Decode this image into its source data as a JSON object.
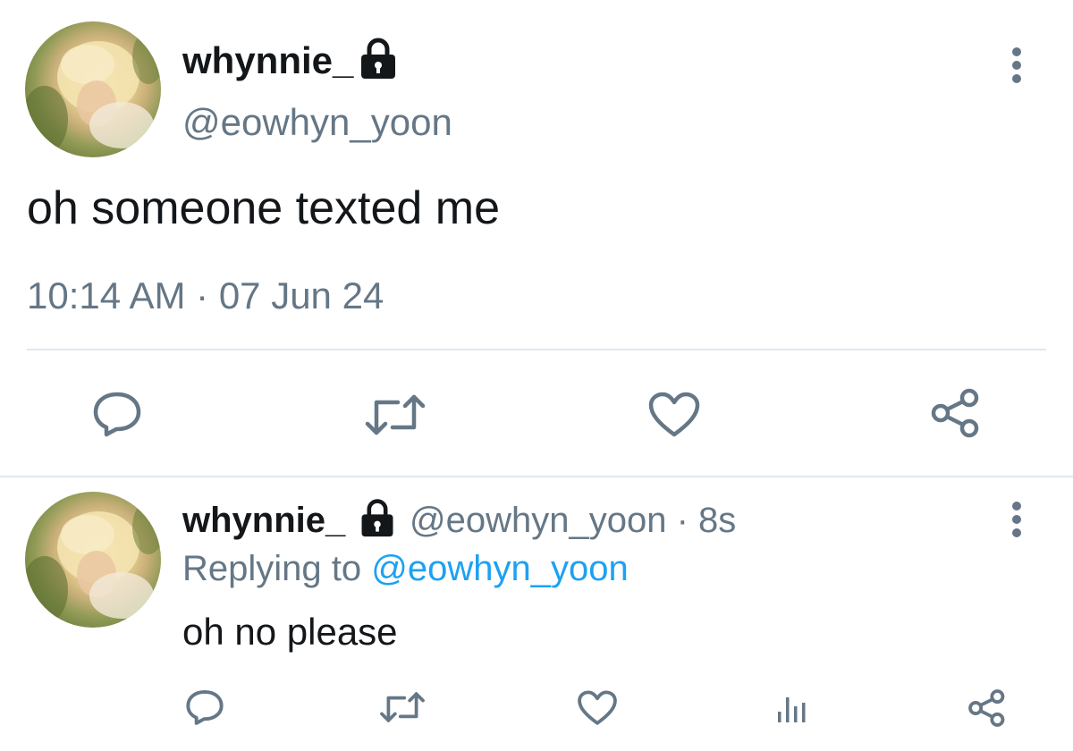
{
  "main_tweet": {
    "display_name": "whynnie_",
    "handle": "@eowhyn_yoon",
    "text": "oh someone texted me",
    "timestamp": "10:14 AM",
    "date_separator": "·",
    "date": "07 Jun 24",
    "icons": {
      "protected": "lock-icon",
      "more": "more-vertical-icon",
      "reply": "reply-icon",
      "retweet": "retweet-icon",
      "like": "heart-icon",
      "share": "share-icon"
    }
  },
  "reply_tweet": {
    "display_name": "whynnie_",
    "handle": "@eowhyn_yoon",
    "separator": "·",
    "time_ago": "8s",
    "replying_to_label": "Replying to",
    "replying_to_handle": "@eowhyn_yoon",
    "text": "oh no please",
    "icons": {
      "protected": "lock-icon",
      "more": "more-vertical-icon",
      "reply": "reply-icon",
      "retweet": "retweet-icon",
      "like": "heart-icon",
      "analytics": "analytics-icon",
      "share": "share-icon"
    }
  },
  "colors": {
    "text_primary": "#14171a",
    "text_secondary": "#657786",
    "link": "#1da1f2",
    "divider": "#e1e8ed"
  }
}
